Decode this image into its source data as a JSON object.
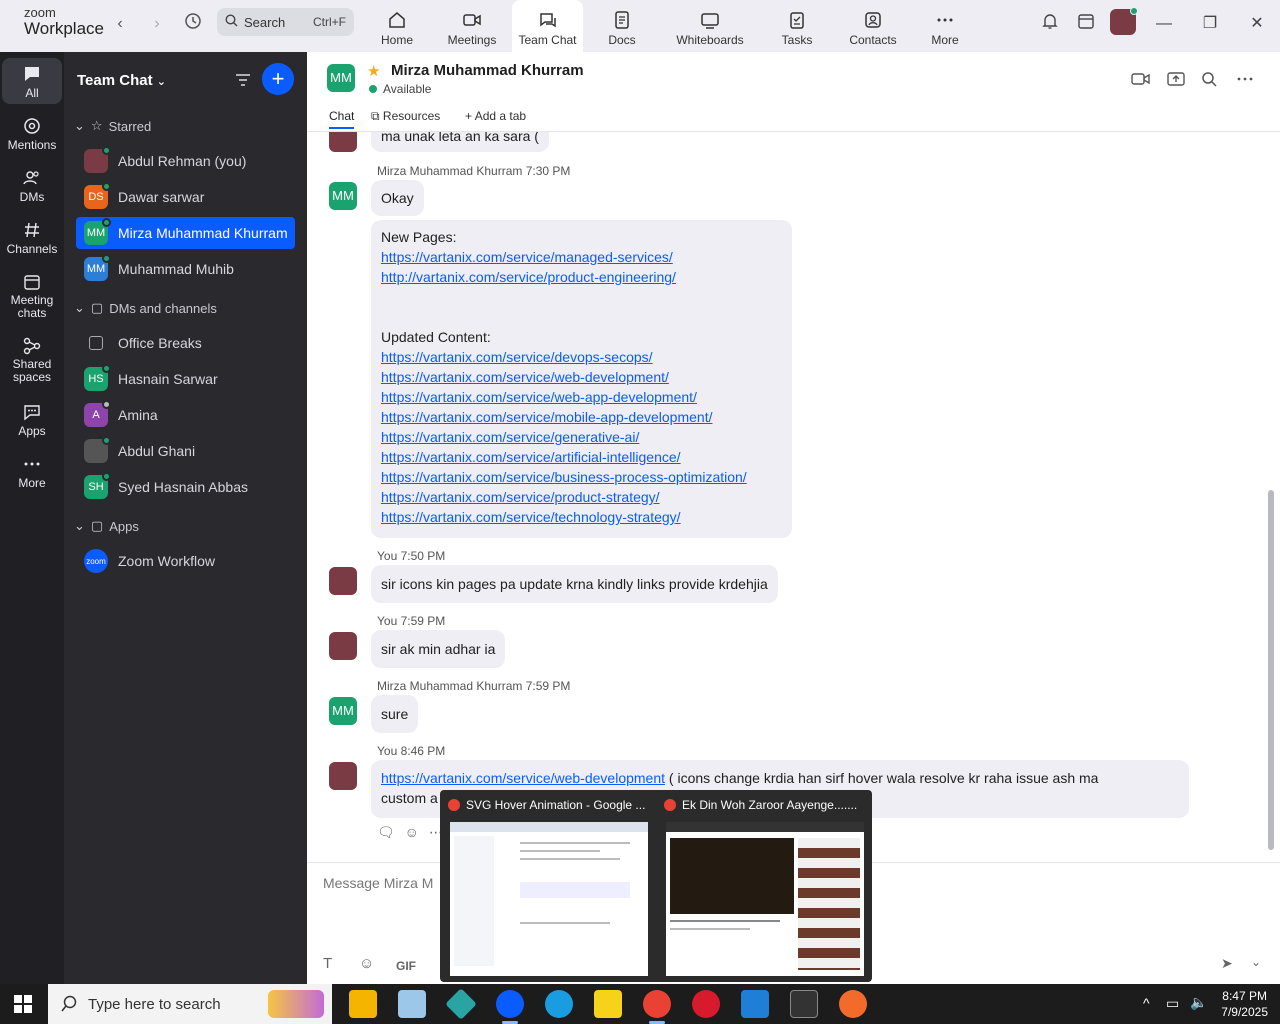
{
  "app": {
    "brand_top": "zoom",
    "brand_bottom": "Workplace"
  },
  "search": {
    "label": "Search",
    "shortcut": "Ctrl+F"
  },
  "tabs": [
    {
      "label": "Home",
      "icon": "home-icon"
    },
    {
      "label": "Meetings",
      "icon": "video-icon"
    },
    {
      "label": "Team Chat",
      "icon": "chat-icon"
    },
    {
      "label": "Docs",
      "icon": "doc-icon"
    },
    {
      "label": "Whiteboards",
      "icon": "whiteboard-icon"
    },
    {
      "label": "Tasks",
      "icon": "tasks-icon"
    },
    {
      "label": "Contacts",
      "icon": "contacts-icon"
    },
    {
      "label": "More",
      "icon": "more-icon"
    }
  ],
  "rail": [
    {
      "label": "All"
    },
    {
      "label": "Mentions"
    },
    {
      "label": "DMs"
    },
    {
      "label": "Channels"
    },
    {
      "label": "Meeting chats"
    },
    {
      "label": "Shared spaces"
    },
    {
      "label": "Apps"
    },
    {
      "label": "More"
    }
  ],
  "sidebar": {
    "title": "Team Chat",
    "starred_label": "Starred",
    "starred": [
      {
        "name": "Abdul Rehman (you)",
        "initials": "",
        "color": "#7a3b44",
        "status": "#1aa36e"
      },
      {
        "name": "Dawar sarwar",
        "initials": "DS",
        "color": "#e8661b",
        "status": "#1aa36e"
      },
      {
        "name": "Mirza Muhammad Khurram",
        "initials": "MM",
        "color": "#1aa36e",
        "status": "#1aa36e"
      },
      {
        "name": "Muhammad Muhib",
        "initials": "MM",
        "color": "#2c7fd6",
        "status": "#1aa36e"
      }
    ],
    "dms_label": "DMs and channels",
    "dms": [
      {
        "name": "Office Breaks",
        "initials": "",
        "color": "transparent",
        "status": ""
      },
      {
        "name": "Hasnain Sarwar",
        "initials": "HS",
        "color": "#1aa36e",
        "status": "#1aa36e"
      },
      {
        "name": "Amina",
        "initials": "A",
        "color": "#8e44ad",
        "status": "#bbbbbb"
      },
      {
        "name": "Abdul Ghani",
        "initials": "",
        "color": "#555555",
        "status": "#1aa36e"
      },
      {
        "name": "Syed Hasnain Abbas",
        "initials": "SH",
        "color": "#1aa36e",
        "status": "#1aa36e"
      }
    ],
    "apps_label": "Apps",
    "apps": [
      {
        "name": "Zoom Workflow",
        "initials": "zoom",
        "color": "#0b5cff",
        "status": ""
      }
    ]
  },
  "chat": {
    "initials": "MM",
    "name": "Mirza Muhammad Khurram",
    "status": "Available",
    "tabs": [
      "Chat",
      "Resources",
      "Add a tab"
    ]
  },
  "messages": {
    "partial_top": "ma unak leta an ka sara (",
    "m1": {
      "sender": "Mirza Muhammad Khurram 7:30 PM",
      "text": "Okay"
    },
    "m2": {
      "new_label": "New Pages:",
      "new_links": [
        "https://vartanix.com/service/managed-services/",
        "http://vartanix.com/service/product-engineering/"
      ],
      "updated_label": "Updated Content:",
      "updated_links": [
        "https://vartanix.com/service/devops-secops/",
        "https://vartanix.com/service/web-development/",
        "https://vartanix.com/service/web-app-development/",
        "https://vartanix.com/service/mobile-app-development/",
        "https://vartanix.com/service/generative-ai/",
        "https://vartanix.com/service/artificial-intelligence/",
        "https://vartanix.com/service/business-process-optimization/",
        "https://vartanix.com/service/product-strategy/",
        "https://vartanix.com/service/technology-strategy/"
      ]
    },
    "m3": {
      "sender": "You 7:50 PM",
      "text": "sir icons  kin pages pa update krna kindly links provide krdehjia"
    },
    "m4": {
      "sender": "You 7:59 PM",
      "text": "sir ak min adhar ia"
    },
    "m5": {
      "sender": "Mirza Muhammad Khurram 7:59 PM",
      "text": "sure"
    },
    "m6": {
      "sender": "You 8:46 PM",
      "link": "https://vartanix.com/service/web-development",
      "text": " ( icons change krdia han sirf hover wala resolve kr raha issue ash ma",
      "text2": "custom a"
    }
  },
  "compose": {
    "placeholder": "Message Mirza M",
    "gif": "GIF"
  },
  "previews": [
    {
      "title": "SVG Hover Animation - Google ..."
    },
    {
      "title": "Ek Din Woh Zaroor Aayenge......."
    }
  ],
  "taskbar": {
    "search": "Type here to search",
    "time": "8:47 PM",
    "date": "7/9/2025"
  }
}
